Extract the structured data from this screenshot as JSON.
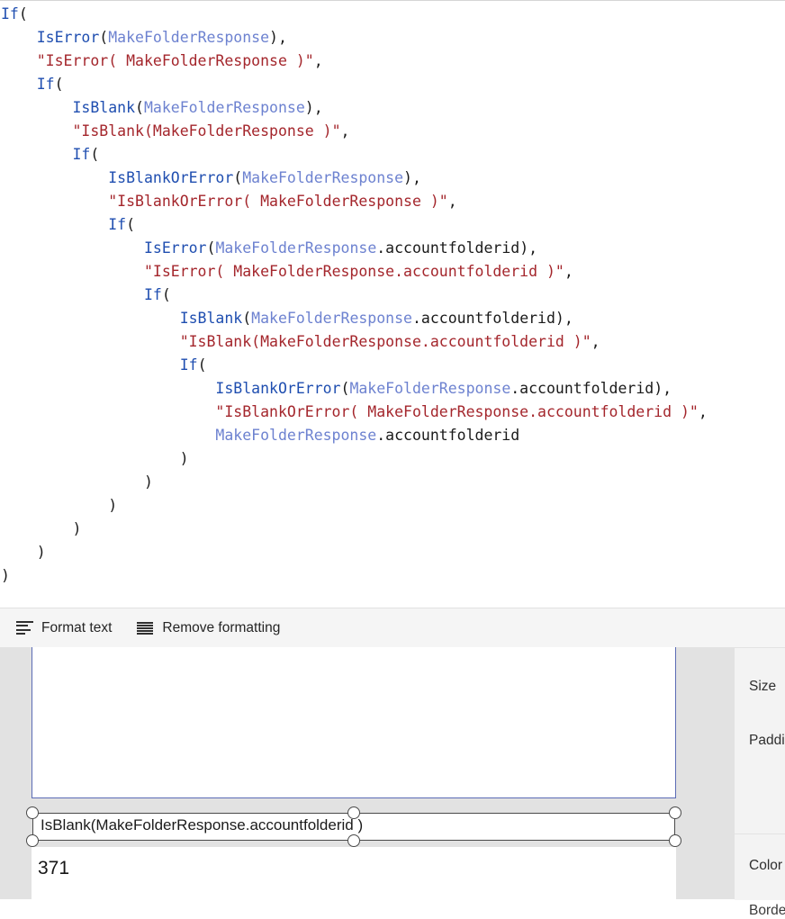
{
  "formula_editor": {
    "name": "power-fx-formula-bar",
    "colors": {
      "function": "#1f4eb0",
      "variable": "#6d82d0",
      "string": "#a4262c",
      "punctuation": "#1a1a1a",
      "background": "#ffffff"
    },
    "lines": [
      [
        {
          "t": "If",
          "c": "fn"
        },
        {
          "t": "(",
          "c": "pn"
        }
      ],
      [
        {
          "t": "    ",
          "c": "pn"
        },
        {
          "t": "IsError",
          "c": "fn"
        },
        {
          "t": "(",
          "c": "pn"
        },
        {
          "t": "MakeFolderResponse",
          "c": "var"
        },
        {
          "t": "),",
          "c": "pn"
        }
      ],
      [
        {
          "t": "    ",
          "c": "pn"
        },
        {
          "t": "\"IsError( MakeFolderResponse )\"",
          "c": "str"
        },
        {
          "t": ",",
          "c": "pn"
        }
      ],
      [
        {
          "t": "    ",
          "c": "pn"
        },
        {
          "t": "If",
          "c": "fn"
        },
        {
          "t": "(",
          "c": "pn"
        }
      ],
      [
        {
          "t": "        ",
          "c": "pn"
        },
        {
          "t": "IsBlank",
          "c": "fn"
        },
        {
          "t": "(",
          "c": "pn"
        },
        {
          "t": "MakeFolderResponse",
          "c": "var"
        },
        {
          "t": "),",
          "c": "pn"
        }
      ],
      [
        {
          "t": "        ",
          "c": "pn"
        },
        {
          "t": "\"IsBlank(MakeFolderResponse )\"",
          "c": "str"
        },
        {
          "t": ",",
          "c": "pn"
        }
      ],
      [
        {
          "t": "        ",
          "c": "pn"
        },
        {
          "t": "If",
          "c": "fn"
        },
        {
          "t": "(",
          "c": "pn"
        }
      ],
      [
        {
          "t": "            ",
          "c": "pn"
        },
        {
          "t": "IsBlankOrError",
          "c": "fn"
        },
        {
          "t": "(",
          "c": "pn"
        },
        {
          "t": "MakeFolderResponse",
          "c": "var"
        },
        {
          "t": "),",
          "c": "pn"
        }
      ],
      [
        {
          "t": "            ",
          "c": "pn"
        },
        {
          "t": "\"IsBlankOrError( MakeFolderResponse )\"",
          "c": "str"
        },
        {
          "t": ",",
          "c": "pn"
        }
      ],
      [
        {
          "t": "            ",
          "c": "pn"
        },
        {
          "t": "If",
          "c": "fn"
        },
        {
          "t": "(",
          "c": "pn"
        }
      ],
      [
        {
          "t": "                ",
          "c": "pn"
        },
        {
          "t": "IsError",
          "c": "fn"
        },
        {
          "t": "(",
          "c": "pn"
        },
        {
          "t": "MakeFolderResponse",
          "c": "var"
        },
        {
          "t": ".accountfolderid),",
          "c": "pn"
        }
      ],
      [
        {
          "t": "                ",
          "c": "pn"
        },
        {
          "t": "\"IsError( MakeFolderResponse.accountfolderid )\"",
          "c": "str"
        },
        {
          "t": ",",
          "c": "pn"
        }
      ],
      [
        {
          "t": "                ",
          "c": "pn"
        },
        {
          "t": "If",
          "c": "fn"
        },
        {
          "t": "(",
          "c": "pn"
        }
      ],
      [
        {
          "t": "                    ",
          "c": "pn"
        },
        {
          "t": "IsBlank",
          "c": "fn"
        },
        {
          "t": "(",
          "c": "pn"
        },
        {
          "t": "MakeFolderResponse",
          "c": "var"
        },
        {
          "t": ".accountfolderid),",
          "c": "pn"
        }
      ],
      [
        {
          "t": "                    ",
          "c": "pn"
        },
        {
          "t": "\"IsBlank(MakeFolderResponse.accountfolderid )\"",
          "c": "str"
        },
        {
          "t": ",",
          "c": "pn"
        }
      ],
      [
        {
          "t": "                    ",
          "c": "pn"
        },
        {
          "t": "If",
          "c": "fn"
        },
        {
          "t": "(",
          "c": "pn"
        }
      ],
      [
        {
          "t": "                        ",
          "c": "pn"
        },
        {
          "t": "IsBlankOrError",
          "c": "fn"
        },
        {
          "t": "(",
          "c": "pn"
        },
        {
          "t": "MakeFolderResponse",
          "c": "var"
        },
        {
          "t": ".accountfolderid),",
          "c": "pn"
        }
      ],
      [
        {
          "t": "                        ",
          "c": "pn"
        },
        {
          "t": "\"IsBlankOrError( MakeFolderResponse.accountfolderid )\"",
          "c": "str"
        },
        {
          "t": ",",
          "c": "pn"
        }
      ],
      [
        {
          "t": "                        ",
          "c": "pn"
        },
        {
          "t": "MakeFolderResponse",
          "c": "var"
        },
        {
          "t": ".accountfolderid",
          "c": "pn"
        }
      ],
      [
        {
          "t": "                    )",
          "c": "pn"
        }
      ],
      [
        {
          "t": "                )",
          "c": "pn"
        }
      ],
      [
        {
          "t": "            )",
          "c": "pn"
        }
      ],
      [
        {
          "t": "        )",
          "c": "pn"
        }
      ],
      [
        {
          "t": "    )",
          "c": "pn"
        }
      ],
      [
        {
          "t": ")",
          "c": "pn"
        }
      ]
    ]
  },
  "format_bar": {
    "format_text_label": "Format text",
    "format_text_icon": "align-left-icon",
    "remove_formatting_label": "Remove formatting",
    "remove_formatting_icon": "lines-icon"
  },
  "designer": {
    "selected_control": {
      "text": "IsBlank(MakeFolderResponse.accountfolderid )",
      "handles": [
        "top-left",
        "top-center",
        "top-right",
        "bottom-left",
        "bottom-center",
        "bottom-right"
      ]
    },
    "below_control": {
      "text": "371"
    }
  },
  "properties_panel": {
    "groups": [
      {
        "rows": [
          "Size",
          "Padding"
        ]
      },
      {
        "rows": [
          "Color",
          "Border"
        ]
      }
    ]
  }
}
